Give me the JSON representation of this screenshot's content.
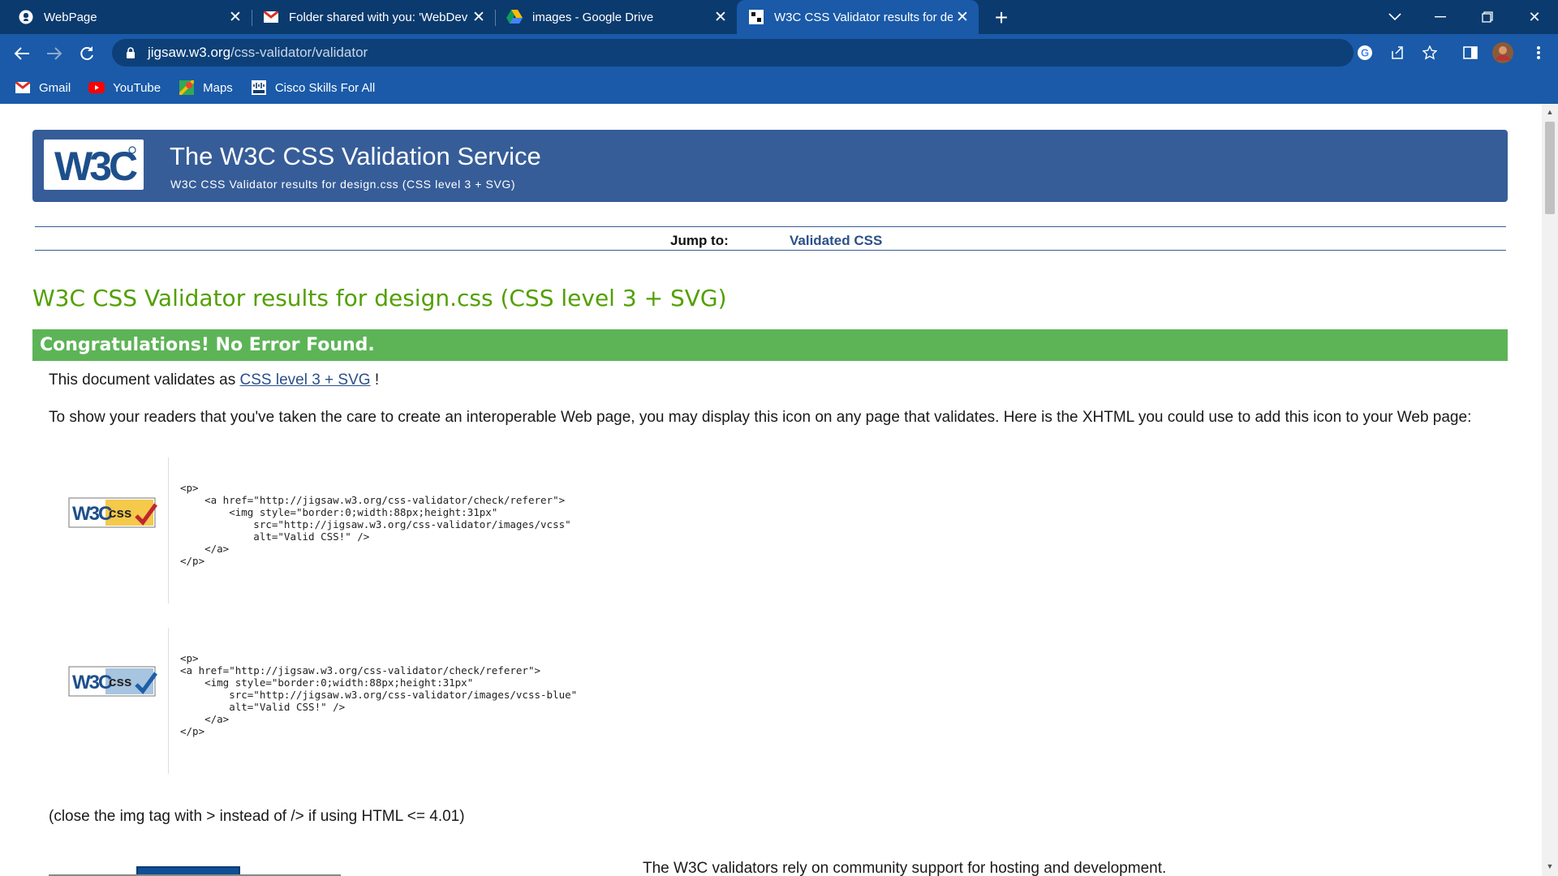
{
  "browser": {
    "tabs": [
      {
        "title": "WebPage",
        "icon": "github-icon"
      },
      {
        "title": "Folder shared with you: 'WebDev",
        "icon": "gmail-icon"
      },
      {
        "title": "images - Google Drive",
        "icon": "google-drive-icon"
      },
      {
        "title": "W3C CSS Validator results for de",
        "icon": "w3c-icon",
        "active": true
      }
    ],
    "address": {
      "host": "jigsaw.w3.org",
      "path": "/css-validator/validator"
    },
    "bookmarks": [
      {
        "label": "Gmail",
        "icon": "gmail-icon"
      },
      {
        "label": "YouTube",
        "icon": "youtube-icon"
      },
      {
        "label": "Maps",
        "icon": "maps-icon"
      },
      {
        "label": "Cisco Skills For All",
        "icon": "cisco-icon"
      }
    ]
  },
  "page": {
    "banner_title": "The W3C CSS Validation Service",
    "banner_subtitle": "W3C CSS Validator results for design.css (CSS level 3 + SVG)",
    "jump_label": "Jump to:",
    "jump_link": "Validated CSS",
    "results_heading": "W3C CSS Validator results for design.css (CSS level 3 + SVG)",
    "congrats": "Congratulations! No Error Found.",
    "validates_prefix": "This document validates as ",
    "validates_link": "CSS level 3 + SVG",
    "validates_suffix": " !",
    "show_readers": "To show your readers that you've taken the care to create an interoperable Web page, you may display this icon on any page that validates. Here is the XHTML you could use to add this icon to your Web page:",
    "badge_gold_alt": "W3C css",
    "code_gold": "<p>\n    <a href=\"http://jigsaw.w3.org/css-validator/check/referer\">\n        <img style=\"border:0;width:88px;height:31px\"\n            src=\"http://jigsaw.w3.org/css-validator/images/vcss\"\n            alt=\"Valid CSS!\" />\n    </a>\n</p>",
    "badge_blue_alt": "W3C css",
    "code_blue": "<p>\n<a href=\"http://jigsaw.w3.org/css-validator/check/referer\">\n    <img style=\"border:0;width:88px;height:31px\"\n        src=\"http://jigsaw.w3.org/css-validator/images/vcss-blue\"\n        alt=\"Valid CSS!\" />\n    </a>\n</p>",
    "close_img_note": "(close the img tag with > instead of /> if using HTML <= 4.01)",
    "footer_partial": "The W3C validators rely on community support for hosting and development."
  },
  "colors": {
    "tabstrip": "#0b3a6e",
    "toolbar": "#1a5aa8",
    "banner": "#365d98",
    "heading_green": "#52a000",
    "congrats_green": "#5db457",
    "link_blue": "#2c5089"
  }
}
